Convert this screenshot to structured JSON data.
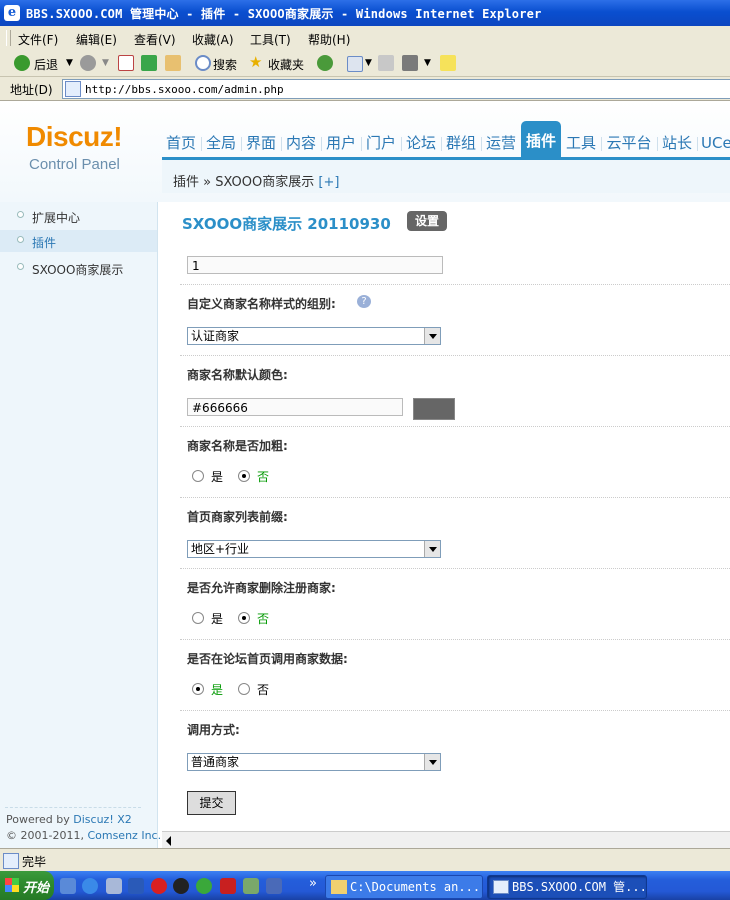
{
  "window": {
    "title": "BBS.SXOOO.COM 管理中心 - 插件 - SXOOO商家展示 - Windows Internet Explorer"
  },
  "menu": [
    "文件(F)",
    "编辑(E)",
    "查看(V)",
    "收藏(A)",
    "工具(T)",
    "帮助(H)"
  ],
  "toolbar": {
    "back": "后退",
    "search": "搜索",
    "favorites": "收藏夹"
  },
  "address": {
    "label": "地址(D)",
    "url": "http://bbs.sxooo.com/admin.php"
  },
  "brand": {
    "logo": "Discuz!",
    "subtitle": "Control Panel"
  },
  "nav": [
    {
      "label": "首页",
      "active": false
    },
    {
      "label": "全局",
      "active": false
    },
    {
      "label": "界面",
      "active": false
    },
    {
      "label": "内容",
      "active": false
    },
    {
      "label": "用户",
      "active": false
    },
    {
      "label": "门户",
      "active": false
    },
    {
      "label": "论坛",
      "active": false
    },
    {
      "label": "群组",
      "active": false
    },
    {
      "label": "运营",
      "active": false
    },
    {
      "label": "插件",
      "active": true
    },
    {
      "label": "工具",
      "active": false
    },
    {
      "label": "云平台",
      "active": false
    },
    {
      "label": "站长",
      "active": false
    },
    {
      "label": "UCenter",
      "active": false
    }
  ],
  "breadcrumb": {
    "text": "插件 » SXOOO商家展示",
    "add": "[+]"
  },
  "sidebar": {
    "items": [
      "扩展中心",
      "插件",
      "SXOOO商家展示"
    ],
    "powered_prefix": "Powered by ",
    "powered_link": "Discuz! X2",
    "copyright_prefix": "© 2001-2011, ",
    "copyright_link": "Comsenz Inc."
  },
  "plugin": {
    "title": "SXOOO商家展示 20110930",
    "settings_button": "设置"
  },
  "form": {
    "first_value": "1",
    "group_label": "自定义商家名称样式的组别:",
    "group_value": "认证商家",
    "color_label": "商家名称默认颜色:",
    "color_value": "#666666",
    "bold_label": "商家名称是否加粗:",
    "yes": "是",
    "no": "否",
    "prefix_label": "首页商家列表前缀:",
    "prefix_value": "地区+行业",
    "allow_delete_label": "是否允许商家删除注册商家:",
    "forum_call_label": "是否在论坛首页调用商家数据:",
    "call_method_label": "调用方式:",
    "call_method_value": "普通商家",
    "submit": "提交"
  },
  "status": {
    "text": "完毕"
  },
  "taskbar": {
    "start": "开始",
    "overflow": "»",
    "tasks": [
      "C:\\Documents an...",
      "BBS.SXOOO.COM 管..."
    ]
  }
}
